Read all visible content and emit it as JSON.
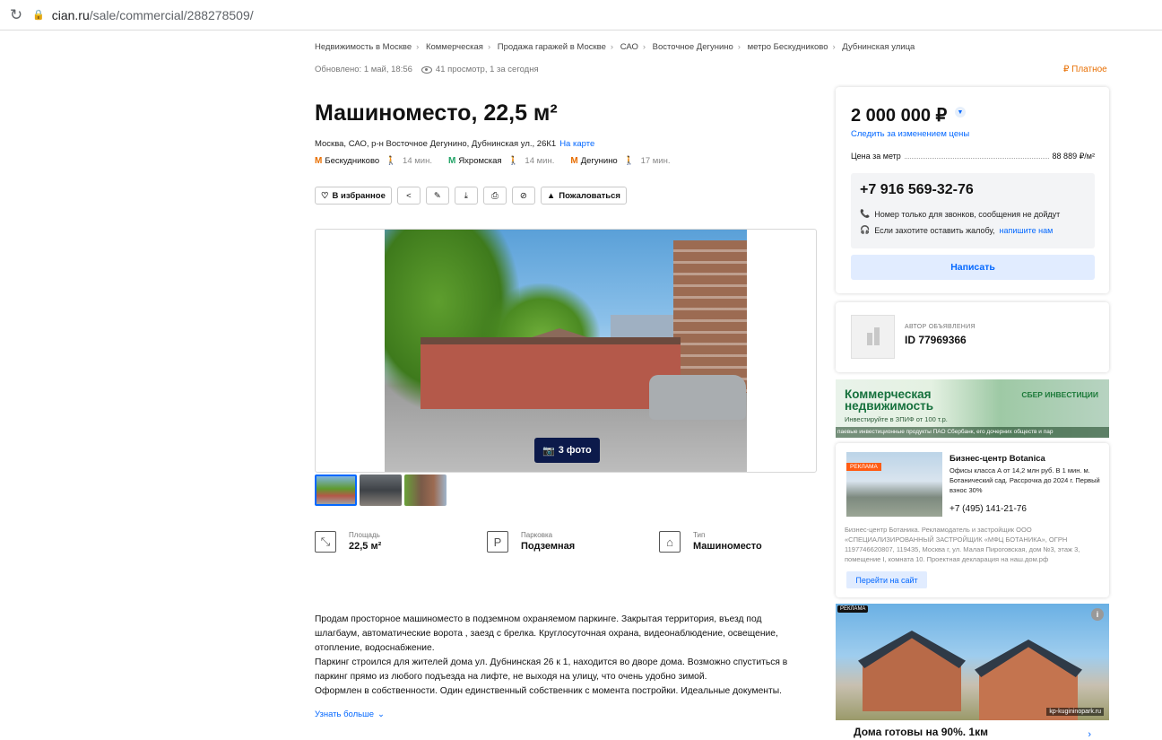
{
  "browser": {
    "host": "cian.ru",
    "path": "/sale/commercial/288278509/"
  },
  "breadcrumbs": [
    "Недвижимость в Москве",
    "Коммерческая",
    "Продажа гаражей в Москве",
    "САО",
    "Восточное Дегунино",
    "метро Бескудниково",
    "Дубнинская улица"
  ],
  "meta": {
    "updated": "Обновлено: 1 май, 18:56",
    "views": "41 просмотр, 1 за сегодня",
    "paid": "Платное"
  },
  "title": "Машиноместо, 22,5 м²",
  "address": {
    "text": "Москва, САО, р-н Восточное Дегунино, Дубнинская ул., 26К1",
    "map_link": "На карте"
  },
  "metros": [
    {
      "name": "Бескудниково",
      "time": "14 мин.",
      "color": "#e86e00"
    },
    {
      "name": "Яхромская",
      "time": "14 мин.",
      "color": "#21a366"
    },
    {
      "name": "Дегунино",
      "time": "17 мин.",
      "color": "#e86e00"
    }
  ],
  "actions": {
    "favorite": "В избранное",
    "complain": "Пожаловаться"
  },
  "gallery": {
    "photos_label": "3 фото"
  },
  "features": [
    {
      "label": "Площадь",
      "value": "22,5 м²",
      "icon": "area-icon"
    },
    {
      "label": "Парковка",
      "value": "Подземная",
      "icon": "parking-icon"
    },
    {
      "label": "Тип",
      "value": "Машиноместо",
      "icon": "garage-icon"
    }
  ],
  "description": {
    "lines": [
      "Продам просторное машиноместо в подземном охраняемом паркинге. Закрытая территория, въезд под",
      "шлагбаум, автоматические ворота , заезд с брелка. Круглосуточная охрана, видеонаблюдение, освещение,",
      "отопление, водоснабжение.",
      "Паркинг строился для жителей дома ул. Дубнинская 26 к 1, находится во дворе дома. Возможно спуститься в",
      "паркинг прямо из любого подъезда на лифте, не выходя на улицу, что очень удобно зимой.",
      "Оформлен в собственности. Один единственный собственник с момента постройки. Идеальные документы."
    ],
    "more": "Узнать больше"
  },
  "price": {
    "value": "2 000 000 ₽",
    "follow": "Следить за изменением цены",
    "per_meter_label": "Цена за метр",
    "per_meter_value": "88 889 ₽/м²",
    "phone": "+7 916 569-32-76",
    "note_calls": "Номер только для звонков, сообщения не дойдут",
    "note_complaint": "Если захотите оставить жалобу,",
    "note_complaint_link": "напишите нам",
    "write_button": "Написать"
  },
  "author": {
    "label": "АВТОР ОБЪЯВЛЕНИЯ",
    "id": "ID 77969366"
  },
  "ad_banner": {
    "title_line1": "Коммерческая",
    "title_line2": "недвижимость",
    "subtitle": "Инвестируйте в ЗПИФ от 100 т.р.",
    "brand": "СБЕР ИНВЕСТИЦИИ",
    "footer": "паевые инвестиционные продукты ПАО Сбербанк, его дочерних обществ и пар"
  },
  "bc_ad": {
    "badge": "РЕКЛАМА",
    "title": "Бизнес-центр Botanica",
    "desc": "Офисы класса А от 14,2 млн руб. В 1 мин. м. Ботанический сад. Рассрочка до 2024 г. Первый взнос 30%",
    "phone": "+7 (495) 141-21-76",
    "legal": "Бизнес-центр Ботаника. Рекламодатель и застройщик ООО «СПЕЦИАЛИЗИРОВАННЫЙ ЗАСТРОЙЩИК «МФЦ БОТАНИКА», ОГРН 1197746620807, 119435, Москва г, ул. Малая Пироговская, дом №3, этаж 3, помещение I, комната 10. Проектная декларация на наш.дом.рф",
    "button": "Перейти на сайт"
  },
  "house_ad": {
    "badge": "РЕКЛАМА",
    "site": "kp-kugininopark.ru",
    "title": "Дома готовы на 90%. 1км"
  }
}
